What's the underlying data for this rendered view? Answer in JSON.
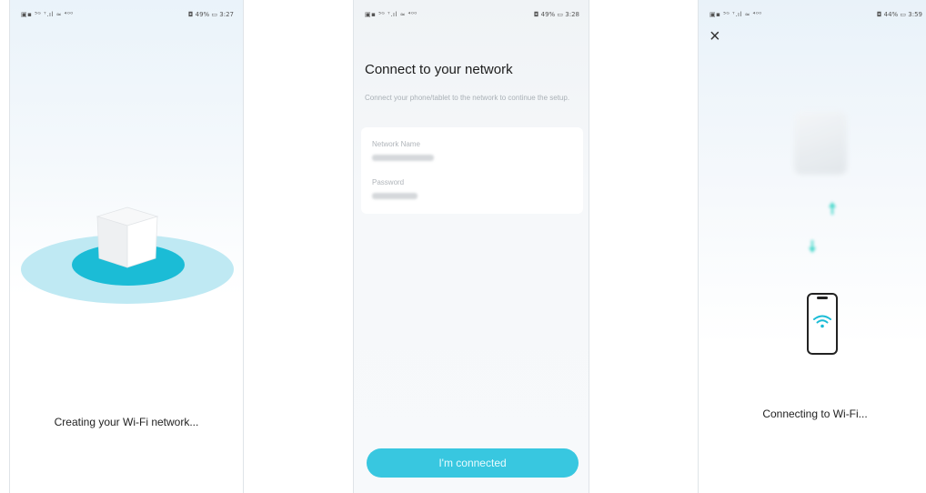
{
  "screen1": {
    "status_left": "▣▪ ⁵ᴳ ᐪ.ıl ≈ ⁴⁰⁰",
    "status_right": "◘ 49% ▭ 3:27",
    "caption": "Creating your Wi-Fi network..."
  },
  "screen2": {
    "status_left": "▣▪ ⁵ᴳ ᐪ.ıl ≈ ⁴⁰⁰",
    "status_right": "◘ 49% ▭ 3:28",
    "title": "Connect to your network",
    "subtitle": "Connect your phone/tablet to the network to continue the setup.",
    "network_name_label": "Network Name",
    "password_label": "Password",
    "button_label": "I'm connected"
  },
  "screen3": {
    "status_left": "▣▪ ⁵ᴳ ᐪ.ıl ≈ ⁴⁰⁰",
    "status_right": "◘ 44% ▭ 3:59",
    "close_icon": "×",
    "caption": "Connecting to Wi-Fi..."
  },
  "colors": {
    "accent": "#1bbcd6",
    "accent_light": "#bfe9f3",
    "button": "#38c7e0",
    "arrow": "#3fd6c9"
  }
}
